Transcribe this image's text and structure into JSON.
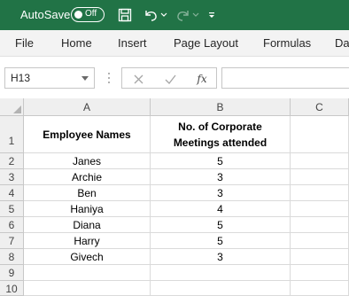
{
  "titlebar": {
    "autosave_label": "AutoSave",
    "autosave_state": "Off",
    "icons": [
      "save-icon",
      "undo-icon",
      "redo-icon",
      "customize-quick-access-icon"
    ],
    "accent_color": "#217346"
  },
  "ribbon": {
    "tabs": [
      "File",
      "Home",
      "Insert",
      "Page Layout",
      "Formulas",
      "Da"
    ]
  },
  "formula_bar": {
    "name_box": "H13",
    "fx_label": "fx",
    "formula_value": ""
  },
  "sheet": {
    "columns": [
      "A",
      "B",
      "C"
    ],
    "rows": [
      "1",
      "2",
      "3",
      "4",
      "5",
      "6",
      "7",
      "8",
      "9",
      "10"
    ],
    "header": {
      "a": "Employee Names",
      "b_line1": "No. of Corporate",
      "b_line2": "Meetings attended"
    },
    "data": [
      {
        "name": "Janes",
        "meetings": "5"
      },
      {
        "name": "Archie",
        "meetings": "3"
      },
      {
        "name": "Ben",
        "meetings": "3"
      },
      {
        "name": "Haniya",
        "meetings": "4"
      },
      {
        "name": "Diana",
        "meetings": "5"
      },
      {
        "name": "Harry",
        "meetings": "5"
      },
      {
        "name": "Givech",
        "meetings": "3"
      }
    ]
  }
}
